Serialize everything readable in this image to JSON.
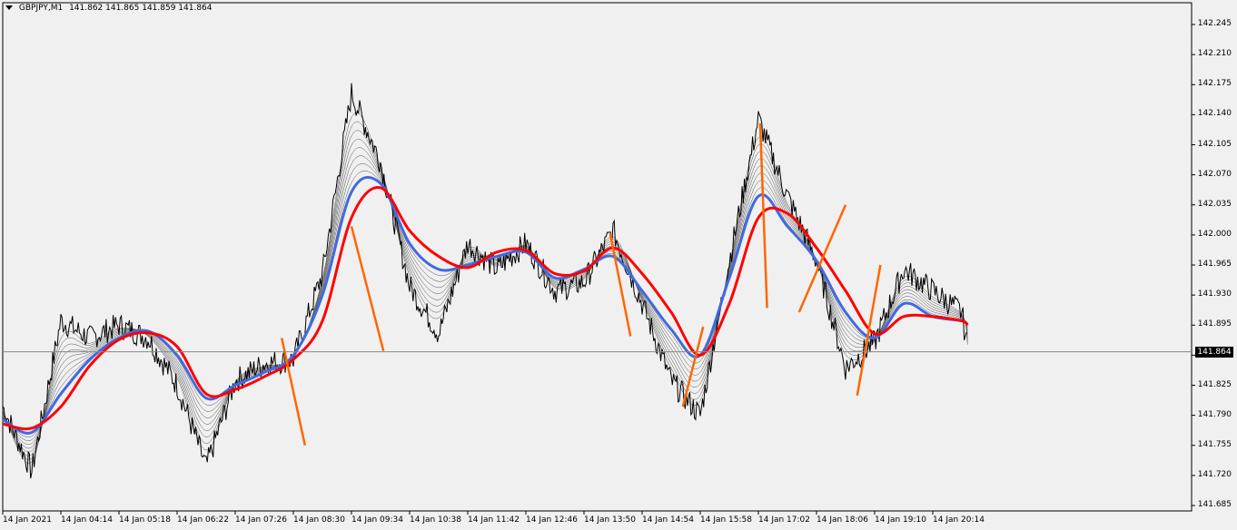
{
  "header": {
    "symbol": "GBPJPY,M1",
    "ohlc": "141.862 141.865 141.859 141.864"
  },
  "current_price_label": "141.864",
  "colors": {
    "background": "#f0f0f0",
    "price_line": "#000000",
    "ribbon_thin": "#000000",
    "ema_fast": "#4169e1",
    "ema_slow": "#ff0000",
    "trend_marks": "#ff6600",
    "bull_bars": "#00a000"
  },
  "chart_data": {
    "type": "line",
    "title": "GBPJPY,M1",
    "ylim": [
      141.685,
      142.245
    ],
    "y_ticks": [
      "142.245",
      "142.210",
      "142.175",
      "142.140",
      "142.105",
      "142.070",
      "142.035",
      "142.000",
      "141.965",
      "141.930",
      "141.895",
      "141.860",
      "141.825",
      "141.790",
      "141.755",
      "141.720",
      "141.685"
    ],
    "x_ticks": [
      "14 Jan 2021",
      "14 Jan 04:14",
      "14 Jan 05:18",
      "14 Jan 06:22",
      "14 Jan 07:26",
      "14 Jan 08:30",
      "14 Jan 09:34",
      "14 Jan 10:38",
      "14 Jan 11:42",
      "14 Jan 12:46",
      "14 Jan 13:50",
      "14 Jan 14:54",
      "14 Jan 15:58",
      "14 Jan 17:02",
      "14 Jan 18:06",
      "14 Jan 19:10",
      "14 Jan 20:14"
    ],
    "current_price": 141.864,
    "grid": false,
    "series": [
      {
        "x": [
          0,
          0.5,
          1,
          1.5,
          2,
          2.5,
          3,
          3.5,
          4,
          4.5,
          5,
          5.5,
          6,
          6.5,
          7,
          7.5,
          8,
          8.5,
          9,
          9.5,
          10,
          10.5,
          11,
          11.5,
          12,
          12.5,
          13,
          13.5,
          14,
          14.5,
          15,
          15.5,
          16,
          16.5,
          16.6
        ],
        "values": [
          141.8,
          141.725,
          141.9,
          141.88,
          141.895,
          141.88,
          141.825,
          141.73,
          141.83,
          141.85,
          141.855,
          141.955,
          142.165,
          142.085,
          141.94,
          141.885,
          141.99,
          141.96,
          141.99,
          141.935,
          141.945,
          142.005,
          141.92,
          141.83,
          141.79,
          141.97,
          142.135,
          142.045,
          141.97,
          141.845,
          141.875,
          141.96,
          141.935,
          141.91,
          141.865
        ]
      },
      {
        "x": [
          0,
          0.5,
          1,
          1.5,
          2,
          2.5,
          3,
          3.5,
          4,
          4.5,
          5,
          5.5,
          6,
          6.5,
          7,
          7.5,
          8,
          8.5,
          9,
          9.5,
          10,
          10.5,
          11,
          11.5,
          12,
          12.5,
          13,
          13.5,
          14,
          14.5,
          15,
          15.5,
          16,
          16.5,
          16.6
        ],
        "values": [
          141.785,
          141.77,
          141.815,
          141.855,
          141.88,
          141.888,
          141.86,
          141.81,
          141.825,
          141.84,
          141.86,
          141.93,
          142.05,
          142.06,
          141.99,
          141.96,
          141.965,
          141.975,
          141.98,
          141.95,
          141.96,
          141.975,
          141.935,
          141.89,
          141.86,
          141.95,
          142.045,
          142.01,
          141.97,
          141.91,
          141.88,
          141.92,
          141.905,
          141.9,
          141.895
        ]
      },
      {
        "x": [
          0,
          0.5,
          1,
          1.5,
          2,
          2.5,
          3,
          3.5,
          4,
          4.5,
          5,
          5.5,
          6,
          6.5,
          7,
          7.5,
          8,
          8.5,
          9,
          9.5,
          10,
          10.5,
          11,
          11.5,
          12,
          12.5,
          13,
          13.5,
          14,
          14.5,
          15,
          15.5,
          16,
          16.5,
          16.6
        ],
        "values": [
          141.78,
          141.775,
          141.8,
          141.848,
          141.878,
          141.886,
          141.87,
          141.815,
          141.82,
          141.835,
          141.855,
          141.9,
          142.02,
          142.055,
          142.005,
          141.975,
          141.962,
          141.98,
          141.982,
          141.955,
          141.958,
          141.985,
          141.955,
          141.91,
          141.86,
          141.92,
          142.02,
          142.025,
          141.985,
          141.935,
          141.885,
          141.905,
          141.905,
          141.9,
          141.895
        ]
      }
    ],
    "annotations": [
      {
        "x": [
          4.8,
          5.2
        ],
        "y": [
          141.88,
          141.755
        ]
      },
      {
        "x": [
          6.0,
          6.55
        ],
        "y": [
          142.01,
          141.865
        ]
      },
      {
        "x": [
          10.45,
          10.8
        ],
        "y": [
          142.002,
          141.882
        ]
      },
      {
        "x": [
          11.7,
          12.05
        ],
        "y": [
          141.8,
          141.893
        ]
      },
      {
        "x": [
          13.03,
          13.15
        ],
        "y": [
          142.13,
          141.915
        ]
      },
      {
        "x": [
          13.7,
          14.5
        ],
        "y": [
          141.91,
          142.035
        ]
      },
      {
        "x": [
          14.7,
          15.1
        ],
        "y": [
          141.813,
          141.965
        ]
      }
    ]
  }
}
